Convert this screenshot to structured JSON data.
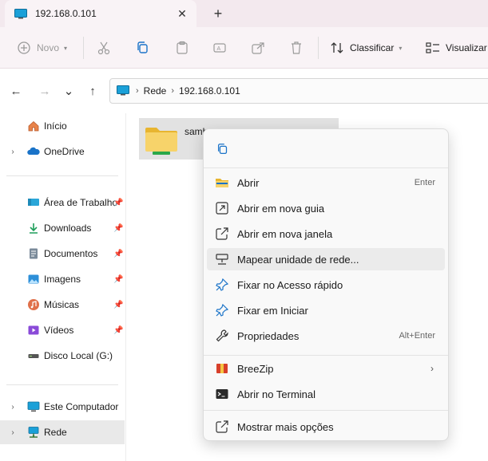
{
  "tab": {
    "title": "192.168.0.101",
    "close_glyph": "✕",
    "new_tab_glyph": "+"
  },
  "toolbar": {
    "new_label": "Novo",
    "sort_label": "Classificar",
    "view_label": "Visualizar"
  },
  "nav": {
    "back_glyph": "←",
    "forward_glyph": "→",
    "recent_glyph": "⌄",
    "up_glyph": "↑"
  },
  "address": {
    "crumbs": [
      "Rede",
      "192.168.0.101"
    ],
    "separator": "›"
  },
  "sidebar": {
    "items": [
      {
        "label": "Início",
        "icon": "home-icon"
      },
      {
        "label": "OneDrive",
        "icon": "onedrive-icon"
      },
      {
        "label": "Área de Trabalho",
        "icon": "desktop-icon"
      },
      {
        "label": "Downloads",
        "icon": "download-icon"
      },
      {
        "label": "Documentos",
        "icon": "documents-icon"
      },
      {
        "label": "Imagens",
        "icon": "pictures-icon"
      },
      {
        "label": "Músicas",
        "icon": "music-icon"
      },
      {
        "label": "Vídeos",
        "icon": "videos-icon"
      },
      {
        "label": "Disco Local (G:)",
        "icon": "drive-icon"
      },
      {
        "label": "Este Computador",
        "icon": "computer-icon"
      },
      {
        "label": "Rede",
        "icon": "network-icon"
      }
    ],
    "expand_glyph": "›",
    "pin_glyph": "📌"
  },
  "content": {
    "file_name": "samba"
  },
  "context_menu": {
    "items": [
      {
        "label": "Abrir",
        "shortcut": "Enter",
        "icon": "folder-open-icon"
      },
      {
        "label": "Abrir em nova guia",
        "shortcut": "",
        "icon": "new-tab-icon"
      },
      {
        "label": "Abrir em nova janela",
        "shortcut": "",
        "icon": "new-window-icon"
      },
      {
        "label": "Mapear unidade de rede...",
        "shortcut": "",
        "icon": "map-drive-icon"
      },
      {
        "label": "Fixar no Acesso rápido",
        "shortcut": "",
        "icon": "pin-icon"
      },
      {
        "label": "Fixar em Iniciar",
        "shortcut": "",
        "icon": "pin-start-icon"
      },
      {
        "label": "Propriedades",
        "shortcut": "Alt+Enter",
        "icon": "wrench-icon"
      },
      {
        "label": "BreeZip",
        "shortcut": "",
        "icon": "breezip-icon"
      },
      {
        "label": "Abrir no Terminal",
        "shortcut": "",
        "icon": "terminal-icon"
      },
      {
        "label": "Mostrar mais opções",
        "shortcut": "",
        "icon": "more-options-icon"
      }
    ],
    "submenu_glyph": "›"
  },
  "colors": {
    "titlebar": "#f3e9ee",
    "toolbar": "#f9f3f6",
    "accent_blue": "#1a73c8",
    "folder_yellow": "#f4c542",
    "selection": "#e9e9e9"
  }
}
